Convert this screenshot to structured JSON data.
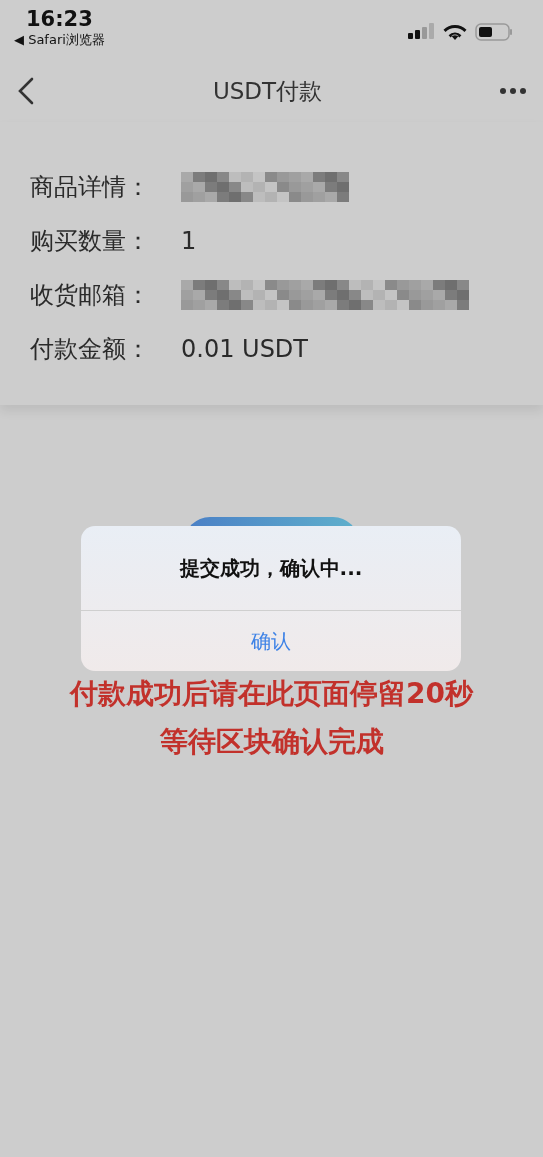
{
  "status_bar": {
    "time": "16:23",
    "back_app": "◀ Safari浏览器"
  },
  "nav_bar": {
    "title": "USDT付款"
  },
  "details": [
    {
      "label": "商品详情：",
      "kind": "redacted"
    },
    {
      "label": "购买数量：",
      "kind": "text",
      "value": "1"
    },
    {
      "label": "收货邮箱：",
      "kind": "redacted"
    },
    {
      "label": "付款金额：",
      "kind": "text",
      "value": "0.01 USDT"
    }
  ],
  "notice": [
    "付款成功后请在此页面停留20秒",
    "等待区块确认完成"
  ],
  "alert": {
    "message": "提交成功，确认中...",
    "button": "确认"
  }
}
